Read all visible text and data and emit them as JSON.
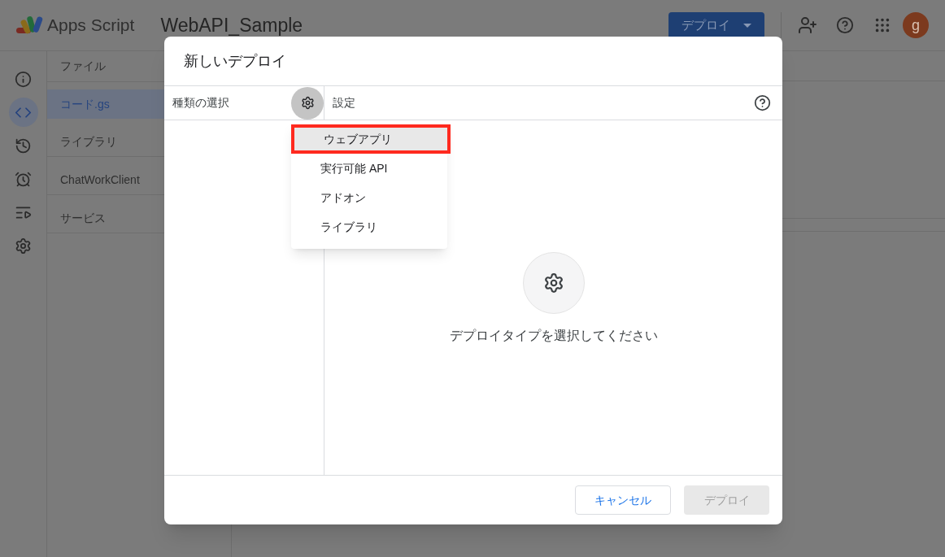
{
  "header": {
    "product": "Apps Script",
    "project": "WebAPI_Sample",
    "deploy_button": "デプロイ",
    "avatar": "g"
  },
  "rail": [
    {
      "kind": "info",
      "selected": false
    },
    {
      "kind": "code",
      "selected": true
    },
    {
      "kind": "history",
      "selected": false
    },
    {
      "kind": "triggers",
      "selected": false
    },
    {
      "kind": "executions",
      "selected": false
    },
    {
      "kind": "settings",
      "selected": false
    }
  ],
  "files": {
    "title": "ファイル",
    "items": [
      {
        "label": "コード.gs",
        "selected": true
      },
      {
        "label": "ライブラリ",
        "selected": false
      },
      {
        "label": "ChatWorkClient",
        "selected": false
      },
      {
        "label": "サービス",
        "selected": false
      }
    ]
  },
  "dialog": {
    "title": "新しいデプロイ",
    "type_label": "種類の選択",
    "settings_label": "設定",
    "empty_message": "デプロイタイプを選択してください",
    "cancel": "キャンセル",
    "deploy": {
      "label": "デプロイ",
      "disabled": true
    }
  },
  "menu": [
    {
      "label": "ウェブアプリ",
      "selected": true
    },
    {
      "label": "実行可能 API",
      "selected": false
    },
    {
      "label": "アドオン",
      "selected": false
    },
    {
      "label": "ライブラリ",
      "selected": false
    }
  ]
}
